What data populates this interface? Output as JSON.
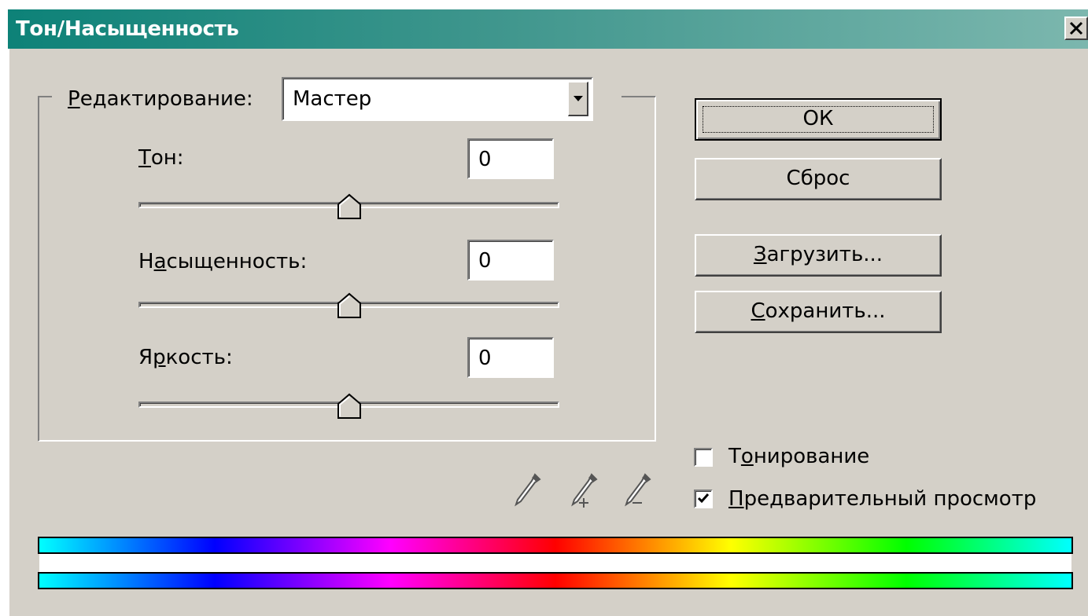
{
  "window": {
    "title": "Тон/Насыщенность",
    "close_label": "✕"
  },
  "edit": {
    "label_u": "Р",
    "label_rest": "едактирование:",
    "value": "Мастер"
  },
  "hue": {
    "label_u": "Т",
    "label_rest": "он:",
    "value": "0",
    "position": 0.5
  },
  "saturation": {
    "label_pre": "Н",
    "label_u": "а",
    "label_rest": "сыщенность:",
    "value": "0",
    "position": 0.5
  },
  "lightness": {
    "label_pre": "Я",
    "label_u": "р",
    "label_rest": "кость:",
    "value": "0",
    "position": 0.5
  },
  "buttons": {
    "ok": "ОК",
    "reset": "Сброс",
    "load_u": "З",
    "load_rest": "агрузить...",
    "save_u": "С",
    "save_rest": "охранить..."
  },
  "colorize": {
    "label_pre": "Т",
    "label_u": "о",
    "label_rest": "нирование",
    "checked": false
  },
  "preview": {
    "label_u": "П",
    "label_rest": "редварительный просмотр",
    "checked": true
  },
  "icons": [
    "eyedropper-icon",
    "eyedropper-plus-icon",
    "eyedropper-minus-icon"
  ]
}
